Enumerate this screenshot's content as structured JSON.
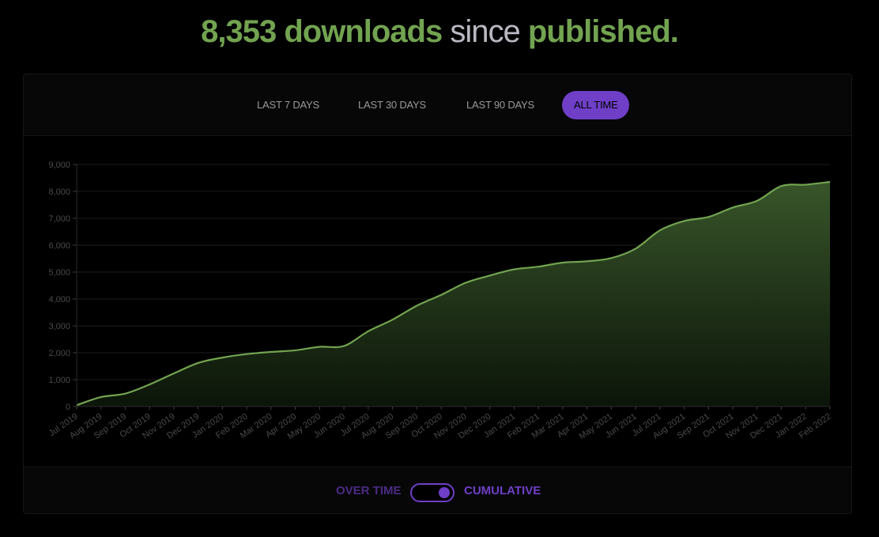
{
  "header": {
    "count": "8,353 downloads",
    "since": "since",
    "published": "published."
  },
  "tabs": [
    {
      "label": "LAST 7 DAYS",
      "active": false
    },
    {
      "label": "LAST 30 DAYS",
      "active": false
    },
    {
      "label": "LAST 90 DAYS",
      "active": false
    },
    {
      "label": "ALL TIME",
      "active": true
    }
  ],
  "toggle": {
    "left_label": "OVER TIME",
    "right_label": "CUMULATIVE",
    "state": "cumulative"
  },
  "colors": {
    "accent": "#6f3fc7",
    "line": "#72a350",
    "background": "#000000"
  },
  "chart_data": {
    "type": "area",
    "title": "",
    "xlabel": "",
    "ylabel": "",
    "ylim": [
      0,
      9000
    ],
    "yticks": [
      0,
      1000,
      2000,
      3000,
      4000,
      5000,
      6000,
      7000,
      8000,
      9000
    ],
    "ytick_labels": [
      "0",
      "1,000",
      "2,000",
      "3,000",
      "4,000",
      "5,000",
      "6,000",
      "7,000",
      "8,000",
      "9,000"
    ],
    "grid": true,
    "legend": "none",
    "categories": [
      "Jul 2019",
      "Aug 2019",
      "Sep 2019",
      "Oct 2019",
      "Nov 2019",
      "Dec 2019",
      "Jan 2020",
      "Feb 2020",
      "Mar 2020",
      "Apr 2020",
      "May 2020",
      "Jun 2020",
      "Jul 2020",
      "Aug 2020",
      "Sep 2020",
      "Oct 2020",
      "Nov 2020",
      "Dec 2020",
      "Jan 2021",
      "Feb 2021",
      "Mar 2021",
      "Apr 2021",
      "May 2021",
      "Jun 2021",
      "Jul 2021",
      "Aug 2021",
      "Sep 2021",
      "Oct 2021",
      "Nov 2021",
      "Dec 2021",
      "Jan 2022",
      "Feb 2022"
    ],
    "series": [
      {
        "values": [
          50,
          350,
          480,
          820,
          1230,
          1620,
          1820,
          1950,
          2030,
          2090,
          2220,
          2250,
          2800,
          3230,
          3750,
          4150,
          4600,
          4870,
          5100,
          5200,
          5350,
          5400,
          5520,
          5870,
          6550,
          6900,
          7050,
          7400,
          7650,
          8200,
          8250,
          8353
        ]
      }
    ]
  }
}
